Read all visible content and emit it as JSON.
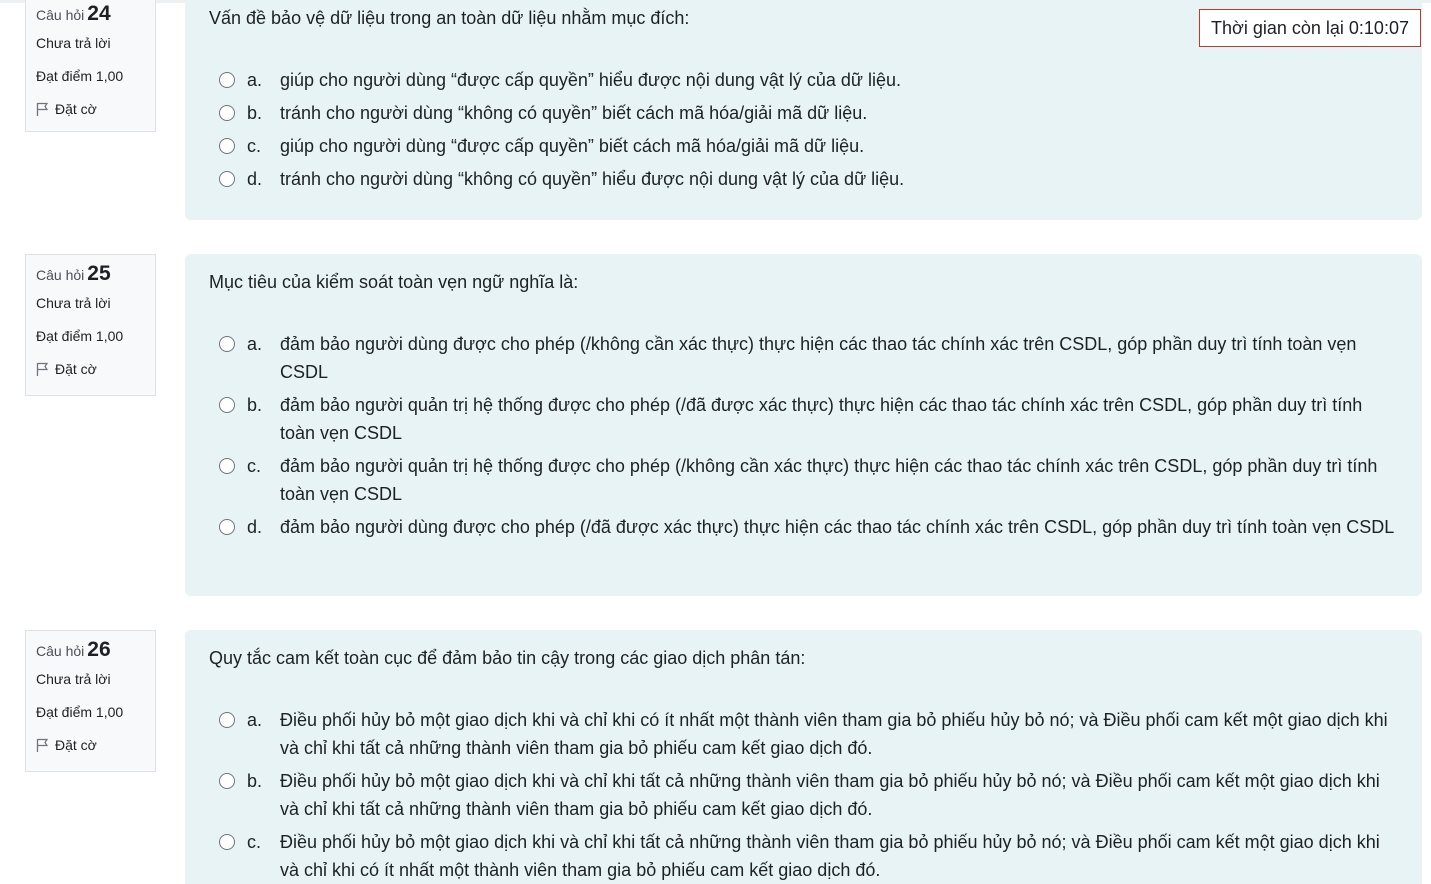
{
  "timer": {
    "label": "Thời gian còn lại",
    "value": "0:10:07"
  },
  "questions": [
    {
      "label": "Câu hỏi",
      "number": "24",
      "status": "Chưa trả lời",
      "mark": "Đạt điểm 1,00",
      "flag": "Đặt cờ",
      "text": "Vấn đề bảo vệ dữ liệu trong an toàn dữ liệu nhằm mục đích:",
      "options": [
        {
          "letter": "a.",
          "text": "giúp cho người dùng “được cấp quyền” hiểu được nội dung vật lý của dữ liệu."
        },
        {
          "letter": "b.",
          "text": "tránh cho người dùng “không có quyền” biết cách mã hóa/giải mã dữ liệu."
        },
        {
          "letter": "c.",
          "text": "giúp cho người dùng “được cấp quyền” biết cách mã hóa/giải mã dữ liệu."
        },
        {
          "letter": "d.",
          "text": "tránh cho người dùng “không có quyền” hiểu được nội dung vật lý của dữ liệu."
        }
      ]
    },
    {
      "label": "Câu hỏi",
      "number": "25",
      "status": "Chưa trả lời",
      "mark": "Đạt điểm 1,00",
      "flag": "Đặt cờ",
      "text": "Mục tiêu của kiểm soát toàn vẹn ngữ nghĩa là:",
      "options": [
        {
          "letter": "a.",
          "text": "đảm bảo người dùng được cho phép (/không cần xác thực) thực hiện các thao tác chính xác trên CSDL, góp phần duy trì tính toàn vẹn CSDL"
        },
        {
          "letter": "b.",
          "text": "đảm bảo người quản trị hệ thống được cho phép (/đã được xác thực) thực hiện các thao tác chính xác trên CSDL, góp phần duy trì tính toàn vẹn CSDL"
        },
        {
          "letter": "c.",
          "text": "đảm bảo người quản trị hệ thống được cho phép (/không cần xác thực) thực hiện các thao tác chính xác trên CSDL, góp phần duy trì tính toàn vẹn CSDL"
        },
        {
          "letter": "d.",
          "text": "đảm bảo người dùng được cho phép (/đã được xác thực) thực hiện các thao tác chính xác trên CSDL, góp phần duy trì tính toàn vẹn CSDL"
        }
      ]
    },
    {
      "label": "Câu hỏi",
      "number": "26",
      "status": "Chưa trả lời",
      "mark": "Đạt điểm 1,00",
      "flag": "Đặt cờ",
      "text": "Quy tắc cam kết toàn cục để đảm bảo tin cậy trong các giao dịch phân tán:",
      "options": [
        {
          "letter": "a.",
          "text": "Điều phối hủy bỏ một giao dịch khi và chỉ khi có ít nhất một thành viên tham gia bỏ phiếu hủy bỏ nó; và Điều phối cam kết một giao dịch khi và chỉ khi tất cả những thành viên tham gia bỏ phiếu cam kết giao dịch đó."
        },
        {
          "letter": "b.",
          "text": "Điều phối hủy bỏ một giao dịch khi và chỉ khi tất cả những thành viên tham gia bỏ phiếu hủy bỏ nó; và Điều phối cam kết một giao dịch khi và chỉ khi tất cả những thành viên tham gia bỏ phiếu cam kết giao dịch đó."
        },
        {
          "letter": "c.",
          "text": "Điều phối hủy bỏ một giao dịch khi và chỉ khi tất cả những thành viên tham gia bỏ phiếu hủy bỏ nó; và Điều phối cam kết một giao dịch khi và chỉ khi có ít nhất một thành viên tham gia bỏ phiếu cam kết giao dịch đó."
        }
      ]
    }
  ]
}
